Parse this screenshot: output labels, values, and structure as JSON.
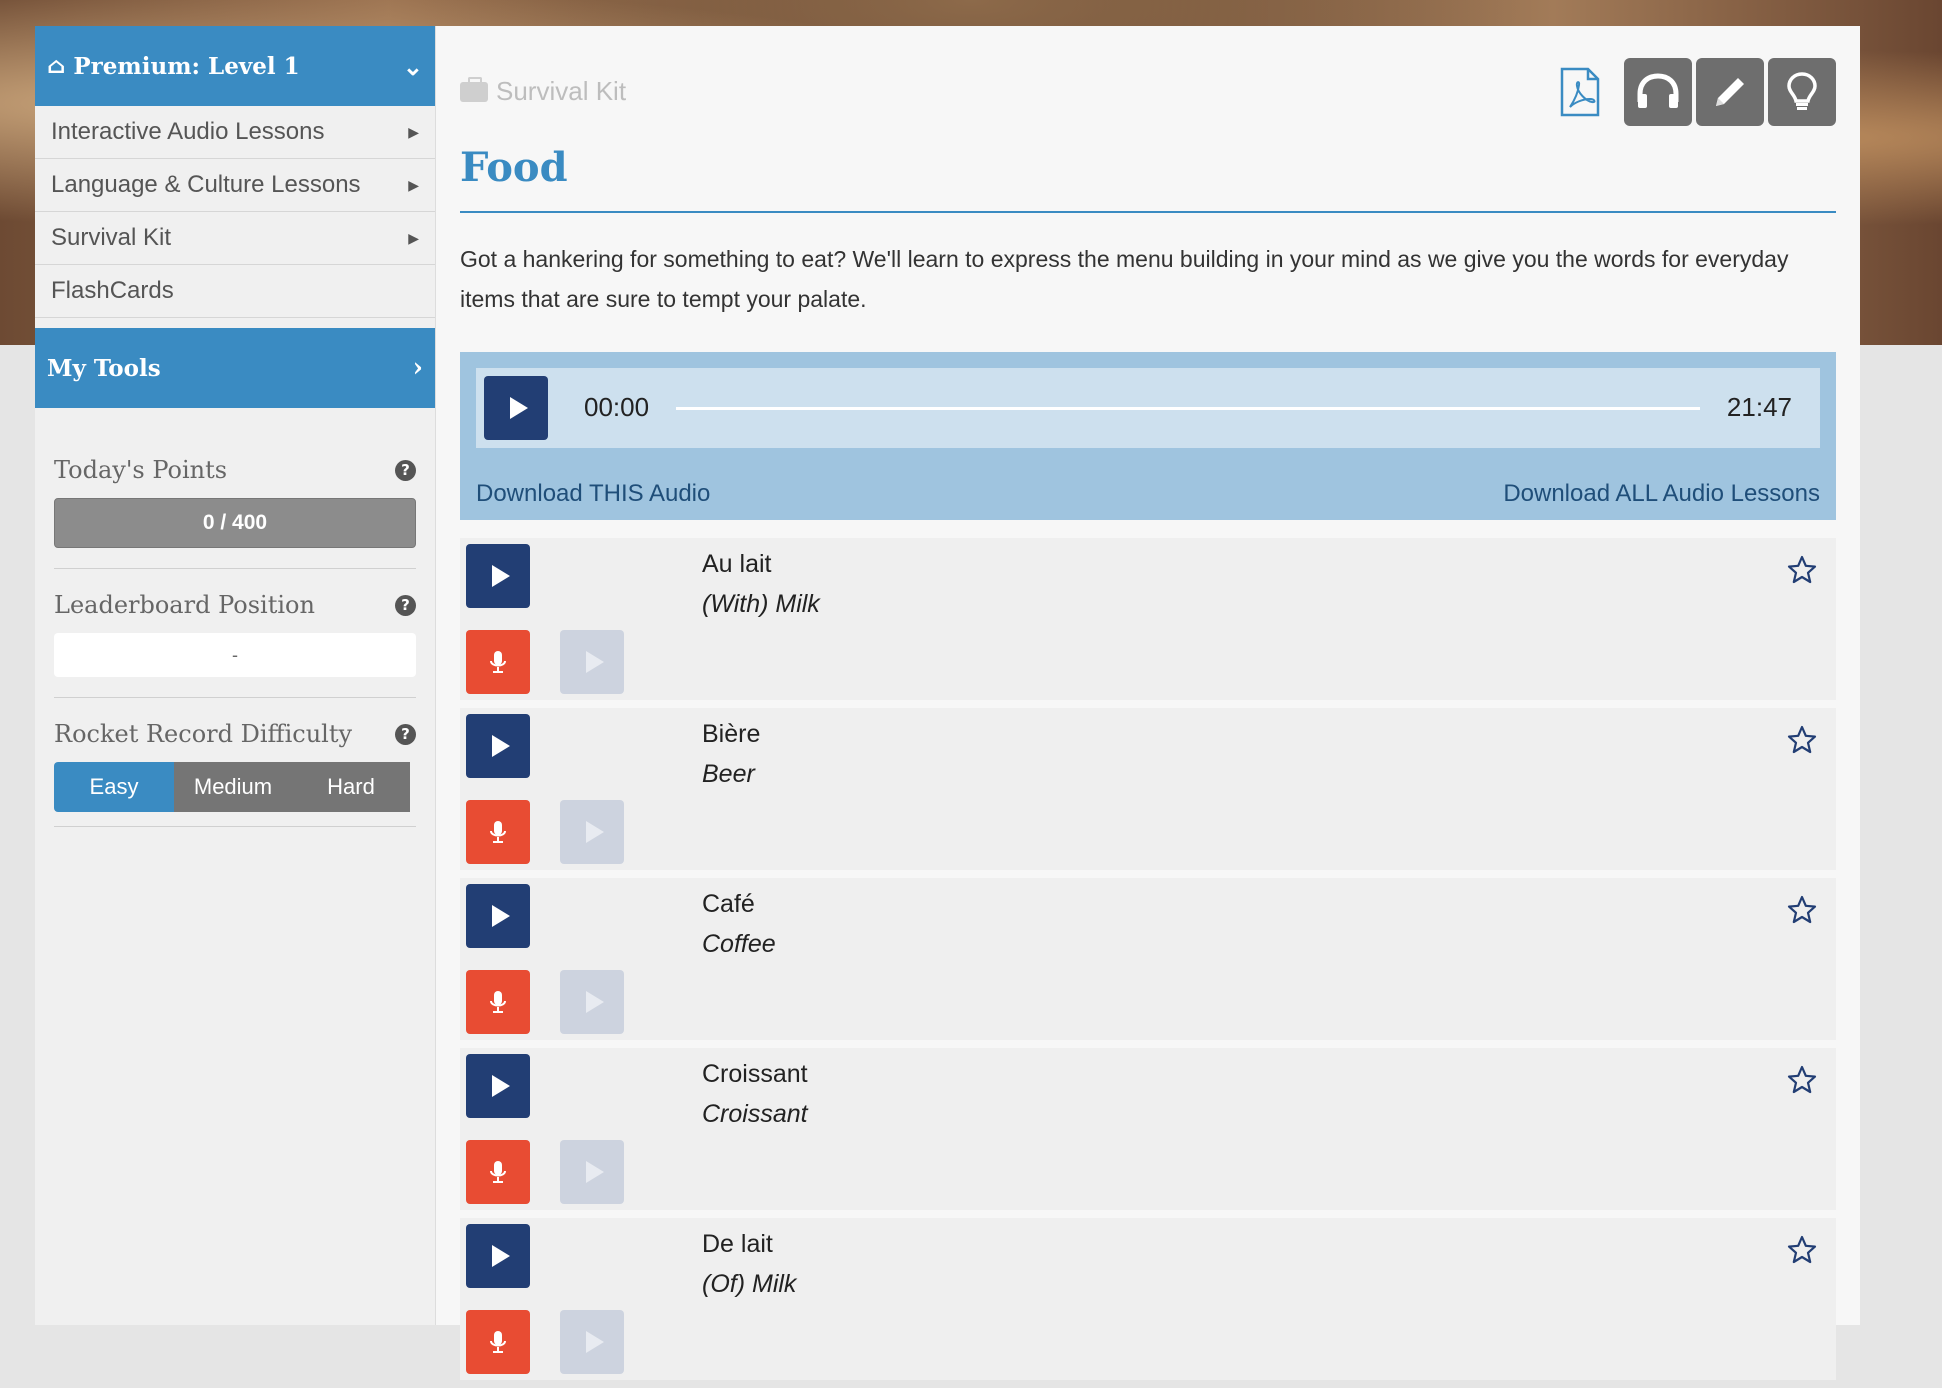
{
  "sidebar": {
    "premium_label": "Premium: Level 1",
    "nav": [
      {
        "label": "Interactive Audio Lessons",
        "has_arrow": true
      },
      {
        "label": "Language & Culture Lessons",
        "has_arrow": true
      },
      {
        "label": "Survival Kit",
        "has_arrow": true
      },
      {
        "label": "FlashCards",
        "has_arrow": false
      }
    ],
    "my_tools_label": "My Tools",
    "todays_points_label": "Today's Points",
    "points_value": "0 / 400",
    "leaderboard_label": "Leaderboard Position",
    "leaderboard_value": "-",
    "difficulty_label": "Rocket Record Difficulty",
    "difficulty_options": [
      "Easy",
      "Medium",
      "Hard"
    ],
    "difficulty_selected": "Easy"
  },
  "main": {
    "breadcrumb": "Survival Kit",
    "title": "Food",
    "description": "Got a hankering for something to eat? We'll learn to express the menu building in your mind as we give you the words for everyday items that are sure to tempt your palate.",
    "player": {
      "current_time": "00:00",
      "total_time": "21:47",
      "progress": 0
    },
    "download_this": "Download THIS Audio",
    "download_all": "Download ALL Audio Lessons",
    "vocab": [
      {
        "word": "Au lait",
        "translation": "(With) Milk"
      },
      {
        "word": "Bière",
        "translation": "Beer"
      },
      {
        "word": "Café",
        "translation": "Coffee"
      },
      {
        "word": "Croissant",
        "translation": "Croissant"
      },
      {
        "word": "De lait",
        "translation": "(Of) Milk"
      }
    ]
  },
  "colors": {
    "accent": "#3a8bc2",
    "player_dark": "#223e74",
    "record_red": "#e84c33"
  }
}
